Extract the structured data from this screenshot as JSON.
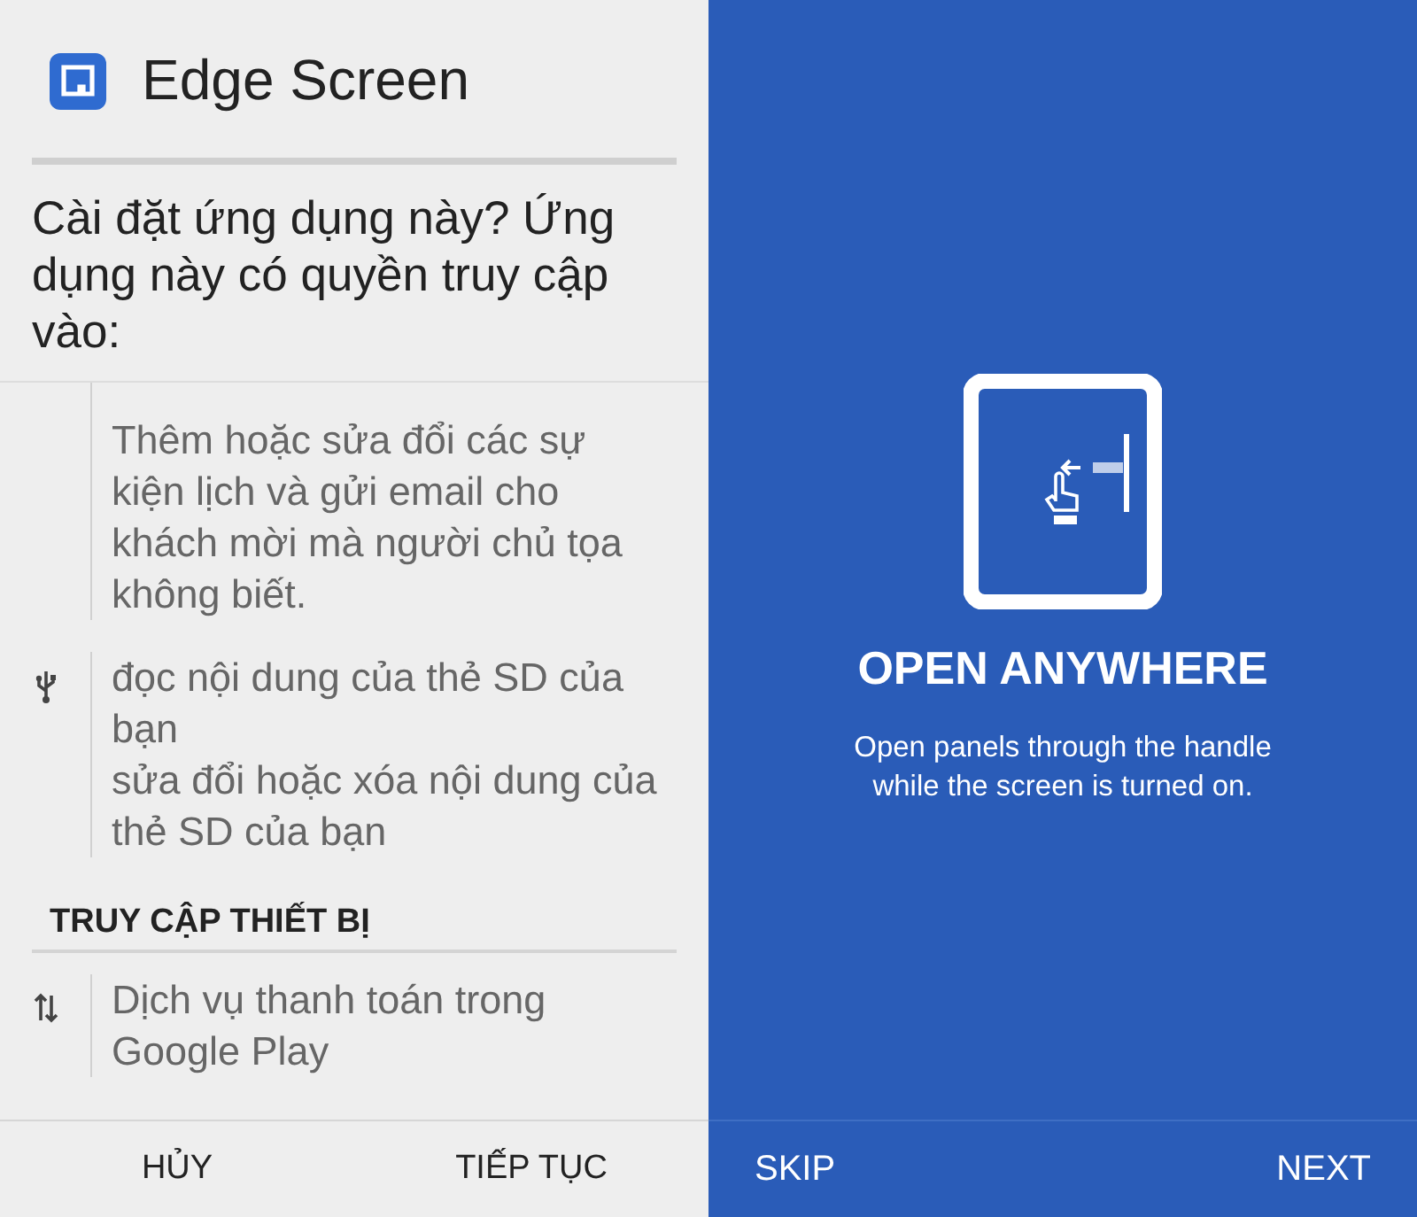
{
  "install_dialog": {
    "app_name": "Edge Screen",
    "question": "Cài đặt ứng dụng này? Ứng dụng này có quyền truy cập vào:",
    "permission_list": [
      {
        "kind": "plain",
        "descriptions": [
          "Thêm hoặc sửa đổi các sự kiện lịch và gửi email cho khách mời mà người chủ tọa không biết."
        ]
      },
      {
        "kind": "usb",
        "descriptions": [
          "đọc nội dung của thẻ SD của bạn",
          "sửa đổi hoặc xóa nội dung của thẻ SD của bạn"
        ]
      },
      {
        "kind": "header",
        "label": "TRUY CẬP THIẾT BỊ"
      },
      {
        "kind": "transfer",
        "descriptions": [
          "Dịch vụ thanh toán trong Google Play"
        ]
      }
    ],
    "buttons": [
      "HỦY",
      "TIẾP TỤC"
    ]
  },
  "intro": {
    "title": "OPEN ANYWHERE",
    "description": "Open panels through the handle while the screen is turned on.",
    "buttons": [
      "SKIP",
      "NEXT"
    ]
  }
}
